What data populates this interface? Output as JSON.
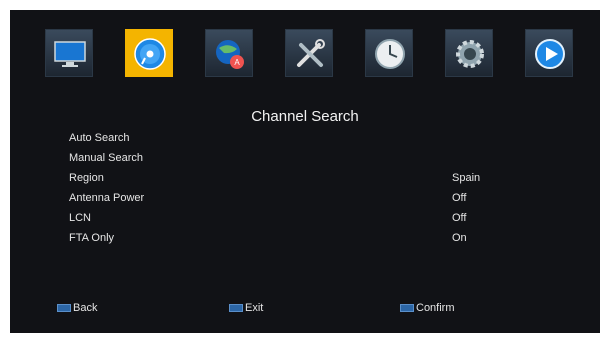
{
  "icons": [
    {
      "name": "tv-monitor-icon",
      "active": false
    },
    {
      "name": "disc-search-icon",
      "active": true
    },
    {
      "name": "globe-apps-icon",
      "active": false
    },
    {
      "name": "tools-icon",
      "active": false
    },
    {
      "name": "clock-icon",
      "active": false
    },
    {
      "name": "gear-icon",
      "active": false
    },
    {
      "name": "play-icon",
      "active": false
    }
  ],
  "title": "Channel Search",
  "menu": [
    {
      "label": "Auto Search",
      "value": ""
    },
    {
      "label": "Manual Search",
      "value": ""
    },
    {
      "label": "Region",
      "value": "Spain"
    },
    {
      "label": "Antenna Power",
      "value": "Off"
    },
    {
      "label": "LCN",
      "value": "Off"
    },
    {
      "label": "FTA Only",
      "value": "On"
    }
  ],
  "footer": {
    "back": "Back",
    "exit": "Exit",
    "confirm": "Confirm"
  },
  "colors": {
    "background": "#111216",
    "highlight": "#f4b400",
    "text": "#e6e6e6"
  }
}
